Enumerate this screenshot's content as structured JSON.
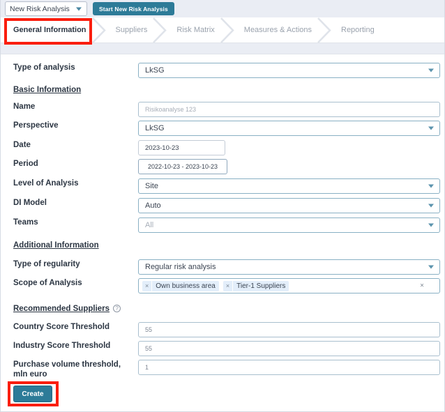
{
  "topbar": {
    "analysis_select_value": "New Risk Analysis",
    "start_button_label": "Start New Risk Analysis"
  },
  "steps": [
    {
      "label": "General Information",
      "active": true
    },
    {
      "label": "Suppliers",
      "active": false
    },
    {
      "label": "Risk Matrix",
      "active": false
    },
    {
      "label": "Measures & Actions",
      "active": false
    },
    {
      "label": "Reporting",
      "active": false
    }
  ],
  "form": {
    "type_of_analysis": {
      "label": "Type of analysis",
      "value": "LkSG"
    },
    "section_basic": "Basic Information",
    "name": {
      "label": "Name",
      "placeholder": "Risikoanalyse 123"
    },
    "perspective": {
      "label": "Perspective",
      "value": "LkSG"
    },
    "date": {
      "label": "Date",
      "value": "2023-10-23"
    },
    "period": {
      "label": "Period",
      "value": "2022-10-23 - 2023-10-23"
    },
    "level_of_analysis": {
      "label": "Level of Analysis",
      "value": "Site"
    },
    "di_model": {
      "label": "DI Model",
      "value": "Auto"
    },
    "teams": {
      "label": "Teams",
      "placeholder": "All"
    },
    "section_additional": "Additional Information",
    "type_of_regularity": {
      "label": "Type of regularity",
      "value": "Regular risk analysis"
    },
    "scope_of_analysis": {
      "label": "Scope of Analysis",
      "tags": [
        "Own business area",
        "Tier-1 Suppliers"
      ],
      "clear_all": "×"
    },
    "section_recommended": "Recommended Suppliers",
    "recommended_help_icon": "?",
    "country_score_threshold": {
      "label": "Country Score Threshold",
      "value": "55"
    },
    "industry_score_threshold": {
      "label": "Industry Score Threshold",
      "value": "55"
    },
    "purchase_volume_threshold": {
      "label": "Purchase volume threshold, mln euro",
      "value": "1"
    },
    "create_button_label": "Create"
  },
  "colors": {
    "accent_teal": "#2d7b98",
    "annotation_red": "#fa1e0e",
    "field_border": "#89b0c4",
    "topbar_bg": "#eaedf4",
    "tag_bg": "#e3eefa"
  },
  "icons": {
    "chevron_down": "caret-down-icon",
    "tag_remove": "×"
  }
}
